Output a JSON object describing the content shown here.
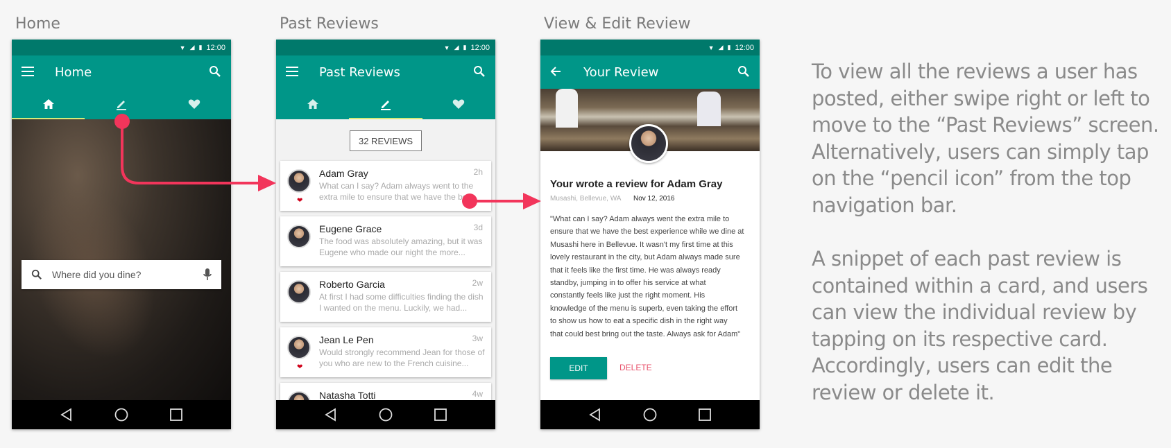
{
  "screens": [
    {
      "title": "Home"
    },
    {
      "title": "Past Reviews"
    },
    {
      "title": "View & Edit Review"
    }
  ],
  "status_time": "12:00",
  "home": {
    "appbar_title": "Home",
    "search_placeholder": "Where did you dine?"
  },
  "past_reviews": {
    "appbar_title": "Past Reviews",
    "count_label": "32 REVIEWS",
    "cards": [
      {
        "name": "Adam Gray",
        "time": "2h",
        "snippet": "What can I say? Adam always went to the extra mile to ensure that we have the best",
        "liked": true
      },
      {
        "name": "Eugene Grace",
        "time": "3d",
        "snippet": "The food was absolutely amazing, but it was Eugene who made our night the more...",
        "liked": false
      },
      {
        "name": "Roberto Garcia",
        "time": "2w",
        "snippet": "At first I had some difficulties finding the dish I wanted on the menu. Luckily, we had...",
        "liked": false
      },
      {
        "name": "Jean Le Pen",
        "time": "3w",
        "snippet": "Would strongly recommend Jean for those of you who are new to the French cuisine...",
        "liked": true
      },
      {
        "name": "Natasha Totti",
        "time": "4w",
        "snippet": "",
        "liked": false
      }
    ]
  },
  "review": {
    "appbar_title": "Your Review",
    "heading": "Your wrote a review for Adam Gray",
    "location": "Musashi, Bellevue, WA",
    "date": "Nov 12, 2016",
    "body_lines": [
      "\"What can I say? Adam always went the extra mile to",
      "ensure that we have the best experience while we dine at",
      "Musashi here in Bellevue. It wasn't my first time at this",
      "lovely restaurant in the city, but Adam always made sure",
      "that it feels like the first time. He was always ready",
      "standby, jumping in to offer his service at what",
      "constantly feels like just the right moment. His",
      "knowledge of the menu is superb, even taking the effort",
      "to show us how to eat a specific dish in the right way",
      "that could best bring out the taste. Always ask for Adam\""
    ],
    "edit_label": "EDIT",
    "delete_label": "DELETE"
  },
  "description": {
    "paragraph1": "To view all the reviews a user has posted, either swipe right or left to move to the “Past Reviews” screen. Alternatively, users can simply tap on the “pencil icon” from the top navigation bar.",
    "paragraph2": "A snippet of each past review is contained within a card, and users can view the individual review by tapping on its respective card. Accordingly, users can edit the review or delete it."
  },
  "colors": {
    "primary": "#009688",
    "primary_dark": "#00796b",
    "accent_arrow": "#f2355b",
    "like": "#d0021b"
  },
  "icons": [
    "menu-icon",
    "search-icon",
    "home-icon",
    "pencil-icon",
    "heart-icon",
    "mic-icon",
    "back-arrow-icon",
    "nav-back-icon",
    "nav-home-icon",
    "nav-recents-icon",
    "wifi-icon",
    "signal-icon",
    "battery-icon"
  ]
}
